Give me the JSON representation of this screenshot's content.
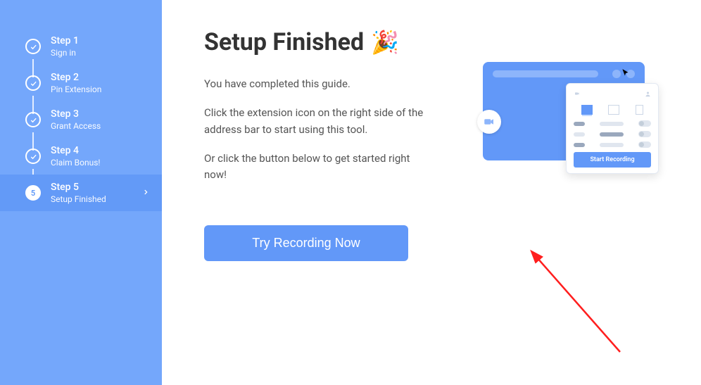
{
  "sidebar": {
    "steps": [
      {
        "title": "Step 1",
        "sub": "Sign in"
      },
      {
        "title": "Step 2",
        "sub": "Pin Extension"
      },
      {
        "title": "Step 3",
        "sub": "Grant Access"
      },
      {
        "title": "Step 4",
        "sub": "Claim Bonus!"
      },
      {
        "title": "Step 5",
        "sub": "Setup Finished",
        "badge": "5"
      }
    ]
  },
  "main": {
    "heading": "Setup Finished",
    "p1": "You have completed this guide.",
    "p2": "Click the extension icon on the right side of the address bar to start using this tool.",
    "p3": "Or click the button below to get started right now!",
    "cta": "Try Recording Now"
  },
  "illustration": {
    "popup_button": "Start Recording"
  }
}
